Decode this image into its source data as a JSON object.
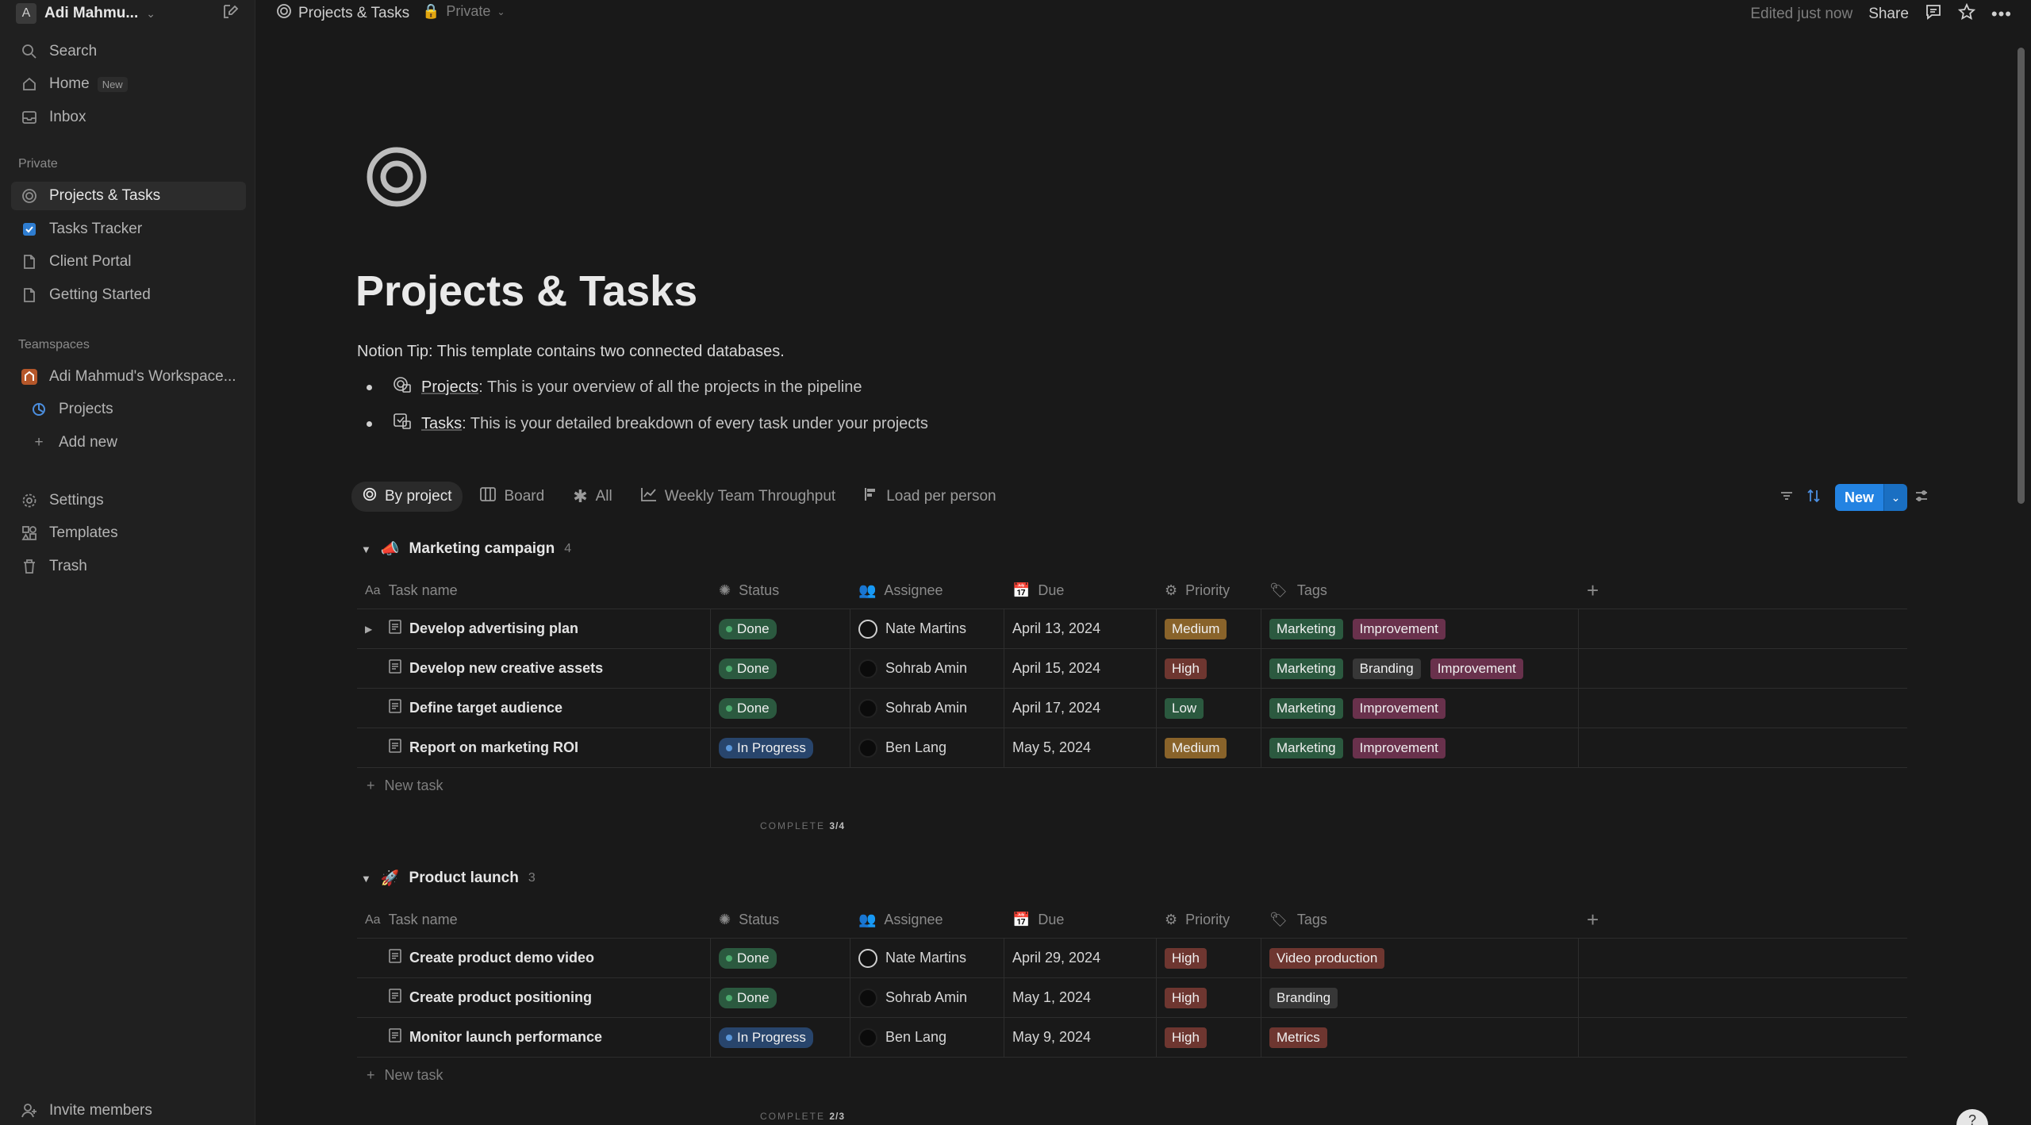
{
  "sidebar": {
    "workspace_initial": "A",
    "workspace_name": "Adi Mahmu...",
    "search": "Search",
    "home": "Home",
    "home_badge": "New",
    "inbox": "Inbox",
    "private_label": "Private",
    "private_items": [
      "Projects & Tasks",
      "Tasks Tracker",
      "Client Portal",
      "Getting Started"
    ],
    "teamspaces_label": "Teamspaces",
    "teamspace_name": "Adi Mahmud's Workspace...",
    "teamspace_projects": "Projects",
    "add_new": "Add new",
    "settings": "Settings",
    "templates": "Templates",
    "trash": "Trash",
    "invite": "Invite members"
  },
  "topbar": {
    "crumb_title": "Projects & Tasks",
    "crumb_privacy": "Private",
    "edited": "Edited just now",
    "share": "Share"
  },
  "page": {
    "title": "Projects & Tasks",
    "tip": "Notion Tip: This template contains two connected databases.",
    "bullet1_link": "Projects",
    "bullet1_text": ": This is your overview of all the projects in the pipeline",
    "bullet2_link": "Tasks",
    "bullet2_text": ": This is your detailed breakdown of every task under your projects"
  },
  "views": [
    "By project",
    "Board",
    "All",
    "Weekly Team Throughput",
    "Load per person"
  ],
  "new_button": "New",
  "columns": {
    "name": "Task name",
    "status": "Status",
    "assignee": "Assignee",
    "due": "Due",
    "priority": "Priority",
    "tags": "Tags"
  },
  "colors": {
    "done": "#2b593f",
    "in_progress": "#28456c",
    "medium": "#89632a",
    "high": "#6e3630",
    "low": "#2b593f",
    "marketing": "#2b593f",
    "improvement": "#69314c",
    "branding": "#373737",
    "video": "#6e3630",
    "metrics": "#6e3630"
  },
  "groups": [
    {
      "name": "Marketing campaign",
      "count": "4",
      "complete_label": "COMPLETE",
      "complete_value": "3/4",
      "new_task": "New task",
      "rows": [
        {
          "name": "Develop advertising plan",
          "status": "Done",
          "assignee": "Nate Martins",
          "due": "April 13, 2024",
          "priority": "Medium",
          "tags": [
            "Marketing",
            "Improvement"
          ]
        },
        {
          "name": "Develop new creative assets",
          "status": "Done",
          "assignee": "Sohrab Amin",
          "due": "April 15, 2024",
          "priority": "High",
          "tags": [
            "Marketing",
            "Branding",
            "Improvement"
          ]
        },
        {
          "name": "Define target audience",
          "status": "Done",
          "assignee": "Sohrab Amin",
          "due": "April 17, 2024",
          "priority": "Low",
          "tags": [
            "Marketing",
            "Improvement"
          ]
        },
        {
          "name": "Report on marketing ROI",
          "status": "In Progress",
          "assignee": "Ben Lang",
          "due": "May 5, 2024",
          "priority": "Medium",
          "tags": [
            "Marketing",
            "Improvement"
          ]
        }
      ]
    },
    {
      "name": "Product launch",
      "count": "3",
      "complete_label": "COMPLETE",
      "complete_value": "2/3",
      "new_task": "New task",
      "rows": [
        {
          "name": "Create product demo video",
          "status": "Done",
          "assignee": "Nate Martins",
          "due": "April 29, 2024",
          "priority": "High",
          "tags": [
            "Video production"
          ]
        },
        {
          "name": "Create product positioning",
          "status": "Done",
          "assignee": "Sohrab Amin",
          "due": "May 1, 2024",
          "priority": "High",
          "tags": [
            "Branding"
          ]
        },
        {
          "name": "Monitor launch performance",
          "status": "In Progress",
          "assignee": "Ben Lang",
          "due": "May 9, 2024",
          "priority": "High",
          "tags": [
            "Metrics"
          ]
        }
      ]
    }
  ]
}
